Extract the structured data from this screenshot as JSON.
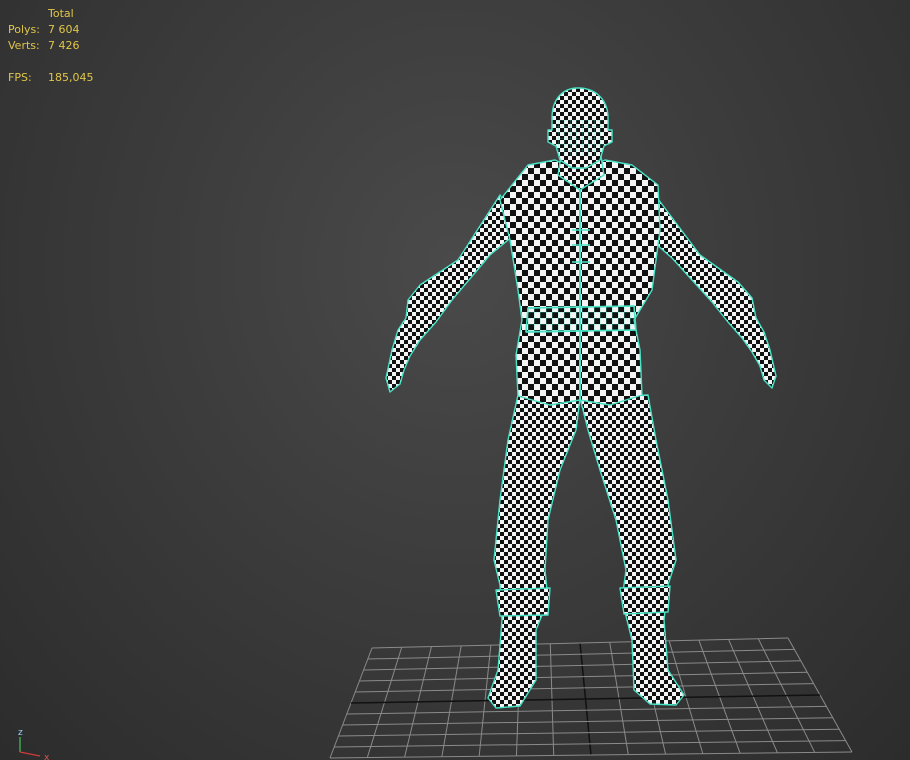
{
  "stats": {
    "header": "Total",
    "polys_label": "Polys:",
    "polys_value": "7 604",
    "verts_label": "Verts:",
    "verts_value": "7 426",
    "fps_label": "FPS:",
    "fps_value": "185,045"
  },
  "gizmo": {
    "z_label": "z",
    "x_label": "x"
  },
  "colors": {
    "wire": "#48e3c6",
    "stats_text": "#e0c64a",
    "grid": "#8a8a8a",
    "grid_axis": "#111111"
  }
}
